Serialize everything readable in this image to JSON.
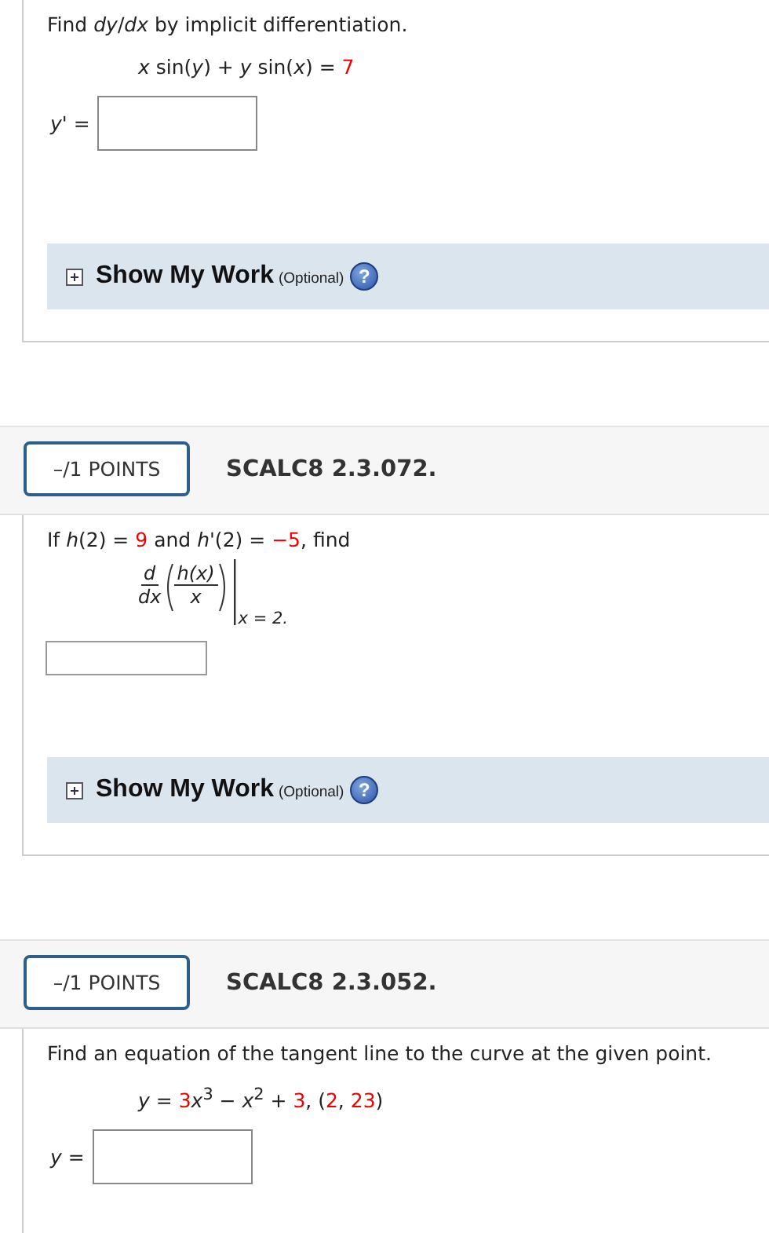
{
  "questions": [
    {
      "prompt": [
        {
          "kind": "plain",
          "text": "Find *dy*/*dx* by implicit differentiation."
        }
      ],
      "equation": [
        {
          "kind": "plain",
          "text": "*x* sin(*y*) + *y* sin(*x*) = "
        },
        {
          "kind": "given",
          "text": "7"
        }
      ],
      "answer": {
        "kind": "large",
        "label": "*y*' ="
      },
      "show_work": {
        "title": "Show My Work",
        "note": "(Optional)",
        "help": "?"
      }
    },
    {
      "header": {
        "points": "–/1 POINTS",
        "code": "SCALC8 2.3.072."
      },
      "prompt": [
        {
          "kind": "plain",
          "text": "If  *h*(2) = "
        },
        {
          "kind": "given",
          "text": "9"
        },
        {
          "kind": "plain",
          "text": " and *h*'(2) = "
        },
        {
          "kind": "given",
          "text": "−5"
        },
        {
          "kind": "plain",
          "text": ",  find"
        }
      ],
      "expression": {
        "operator_top": "d",
        "operator_bottom": "dx",
        "numerator": "h(x)",
        "denominator": "x",
        "evaluated_at": "x = 2."
      },
      "answer": {
        "kind": "small"
      },
      "show_work": {
        "title": "Show My Work",
        "note": "(Optional)",
        "help": "?"
      }
    },
    {
      "header": {
        "points": "–/1 POINTS",
        "code": "SCALC8 2.3.052."
      },
      "prompt": [
        {
          "kind": "plain",
          "text": "Find an equation of the tangent line to the curve at the given point."
        }
      ],
      "equation": [
        {
          "kind": "plain",
          "text": "*y* = "
        },
        {
          "kind": "given",
          "text": "3"
        },
        {
          "kind": "plain",
          "text": "*x*$^{3}$ − *x*$^{2}$ + "
        },
        {
          "kind": "given",
          "text": "3"
        },
        {
          "kind": "plain",
          "text": ",  ("
        },
        {
          "kind": "given",
          "text": "2"
        },
        {
          "kind": "plain",
          "text": ", "
        },
        {
          "kind": "given",
          "text": "23"
        },
        {
          "kind": "plain",
          "text": ")"
        }
      ],
      "answer": {
        "kind": "large",
        "label": "*y* ="
      }
    }
  ]
}
